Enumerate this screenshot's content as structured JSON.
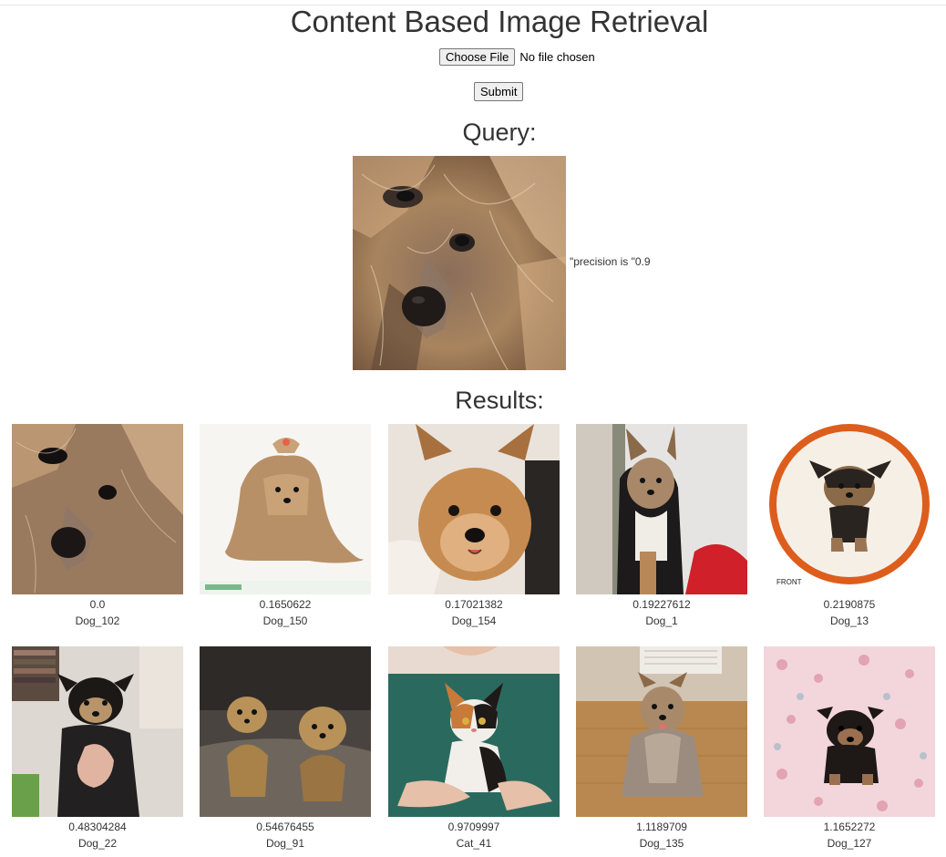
{
  "page": {
    "title": "Content Based Image Retrieval",
    "choose_file_label": "Choose File",
    "no_file_text": "No file chosen",
    "submit_label": "Submit",
    "query_heading": "Query:",
    "precision_text": "\"precision is \"0.9",
    "results_heading": "Results:"
  },
  "results": [
    {
      "score": "0.0",
      "label": "Dog_102"
    },
    {
      "score": "0.1650622",
      "label": "Dog_150"
    },
    {
      "score": "0.17021382",
      "label": "Dog_154"
    },
    {
      "score": "0.19227612",
      "label": "Dog_1"
    },
    {
      "score": "0.2190875",
      "label": "Dog_13"
    },
    {
      "score": "0.48304284",
      "label": "Dog_22"
    },
    {
      "score": "0.54676455",
      "label": "Dog_91"
    },
    {
      "score": "0.9709997",
      "label": "Cat_41"
    },
    {
      "score": "1.1189709",
      "label": "Dog_135"
    },
    {
      "score": "1.1652272",
      "label": "Dog_127"
    }
  ]
}
